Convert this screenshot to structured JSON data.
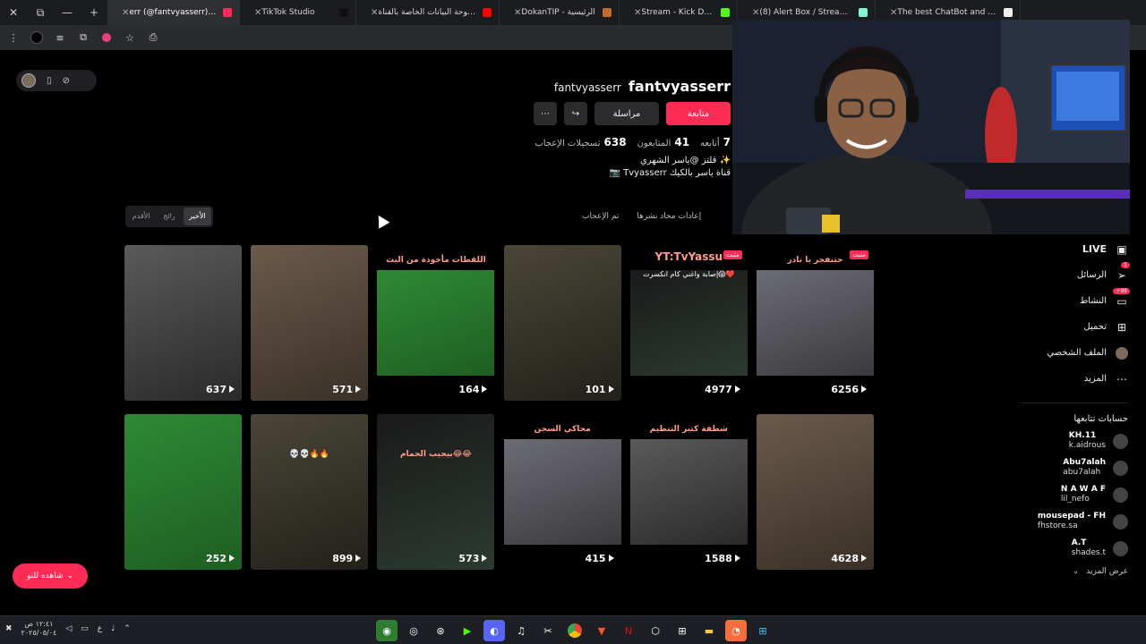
{
  "tabs": [
    {
      "label": "err (@fantvyasserr) | TikTok",
      "active": true,
      "fav_color": "#fe2c55"
    },
    {
      "label": "TikTok Studio",
      "fav_color": "#111111"
    },
    {
      "label": "لوحة البيانات الخاصة بالقناة - dio",
      "fav_color": "#ff0000"
    },
    {
      "label": "DokanTIP - الرئيسية",
      "fav_color": "#c46a2c"
    },
    {
      "label": "Stream - Kick Dashboard",
      "fav_color": "#53fc18"
    },
    {
      "label": "(8) Alert Box / Streamlabs",
      "fav_color": "#80f5d2"
    },
    {
      "label": "The best ChatBot and Widgets",
      "fav_color": "#eeeeee"
    }
  ],
  "profile": {
    "display_name": "fantvyasserr",
    "username": "fantvyasserr",
    "follow_label": "متابعة",
    "message_label": "مراسلة",
    "more_label": "⋯",
    "following_count": "7",
    "following_label": "أتابعه",
    "followers_count": "41",
    "followers_label": "المتابعون",
    "likes_count": "638",
    "likes_label": "تسجيلات الإعجاب",
    "bio_line1": "✨ قلتز @ياسر الشهري",
    "bio_line2": "قناة ياسر بالكيك Tvyasserr 📷"
  },
  "video_tabs": {
    "reposts": "إعادات محاد نشرها",
    "liked": "تم الإعجاب"
  },
  "sort": {
    "latest": "الأخير",
    "popular": "رائج",
    "oldest": "الأقدم"
  },
  "videos_row1": [
    {
      "count": "637"
    },
    {
      "count": "571"
    },
    {
      "count": "164",
      "caption": "اللقطات مأخوذة من البث"
    },
    {
      "count": "101"
    },
    {
      "count": "4977",
      "caption": "YT:TvYassu",
      "sub": "إصابة واغني كام انكسرت😱❤️",
      "pinned": "مثبت"
    },
    {
      "count": "6256",
      "caption": "حتنفجر يا نادر",
      "pinned": "مثبت"
    }
  ],
  "videos_row2": [
    {
      "count": "252"
    },
    {
      "count": "899",
      "caption": "💀💀🔥🔥"
    },
    {
      "count": "573",
      "caption": "بيجيب الحمام😂😂"
    },
    {
      "count": "415",
      "caption": "محاكي السجن"
    },
    {
      "count": "1588",
      "caption": "شطفة كتبر التنظيم"
    },
    {
      "count": "4628"
    }
  ],
  "sidebar": {
    "live": "LIVE",
    "messages": "الرسائل",
    "messages_badge": "1",
    "activity": "النشاط",
    "activity_badge": "99+",
    "upload": "تحميل",
    "profile": "الملف الشخصي",
    "more": "المزيد",
    "following_title": "حسابات تتابعها",
    "accounts": [
      {
        "name": "KH.11",
        "user": "k.aidrous"
      },
      {
        "name": "Abu7alah",
        "user": "abu7alah"
      },
      {
        "name": "N A W A F",
        "user": "lil_nefo"
      },
      {
        "name": "mousepad - FH",
        "user": "fhstore.sa"
      },
      {
        "name": "A.T",
        "user": "shades.t"
      }
    ],
    "see_more": "عرض المزيد"
  },
  "watch_button": "شاهده للتو",
  "taskbar": {
    "time": "١٢:٤١ ص",
    "date": "٢٠٢٥/٠٥/٠٤"
  },
  "colors": {
    "accent": "#fe2c55",
    "background": "#000000"
  }
}
